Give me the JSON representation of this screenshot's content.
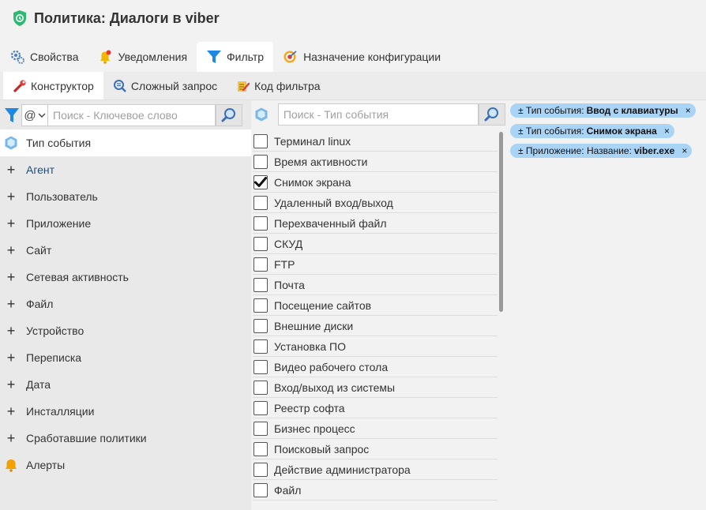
{
  "window": {
    "title": "Политика: Диалоги в viber"
  },
  "tabs": [
    {
      "label": "Свойства",
      "icon": "gear-icon"
    },
    {
      "label": "Уведомления",
      "icon": "bell-icon"
    },
    {
      "label": "Фильтр",
      "icon": "funnel-icon",
      "active": true
    },
    {
      "label": "Назначение конфигурации",
      "icon": "target-icon"
    }
  ],
  "subtabs": [
    {
      "label": "Конструктор",
      "icon": "wrench-icon",
      "active": true
    },
    {
      "label": "Сложный запрос",
      "icon": "query-icon"
    },
    {
      "label": "Код фильтра",
      "icon": "code-icon"
    }
  ],
  "left": {
    "operator": "@",
    "search_placeholder": "Поиск - Ключевое слово",
    "categories": [
      {
        "label": "Тип события",
        "prefix": "cube",
        "selected": true
      },
      {
        "label": "Агент",
        "prefix": "+"
      },
      {
        "label": "Пользователь",
        "prefix": "+"
      },
      {
        "label": "Приложение",
        "prefix": "+"
      },
      {
        "label": "Сайт",
        "prefix": "+"
      },
      {
        "label": "Сетевая активность",
        "prefix": "+"
      },
      {
        "label": "Файл",
        "prefix": "+"
      },
      {
        "label": "Устройство",
        "prefix": "+"
      },
      {
        "label": "Переписка",
        "prefix": "+"
      },
      {
        "label": "Дата",
        "prefix": "+"
      },
      {
        "label": "Инсталляции",
        "prefix": "+"
      },
      {
        "label": "Сработавшие политики",
        "prefix": "+"
      },
      {
        "label": "Алерты",
        "prefix": "bell"
      }
    ]
  },
  "middle": {
    "search_placeholder": "Поиск - Тип события",
    "items": [
      {
        "label": "Терминал linux",
        "checked": false
      },
      {
        "label": "Время активности",
        "checked": false
      },
      {
        "label": "Снимок экрана",
        "checked": true
      },
      {
        "label": "Удаленный вход/выход",
        "checked": false
      },
      {
        "label": "Перехваченный файл",
        "checked": false
      },
      {
        "label": "СКУД",
        "checked": false
      },
      {
        "label": "FTP",
        "checked": false
      },
      {
        "label": "Почта",
        "checked": false
      },
      {
        "label": "Посещение сайтов",
        "checked": false
      },
      {
        "label": "Внешние диски",
        "checked": false
      },
      {
        "label": "Установка ПО",
        "checked": false
      },
      {
        "label": "Видео рабочего стола",
        "checked": false
      },
      {
        "label": "Вход/выход из системы",
        "checked": false
      },
      {
        "label": "Реестр софта",
        "checked": false
      },
      {
        "label": "Бизнес процесс",
        "checked": false
      },
      {
        "label": "Поисковый запрос",
        "checked": false
      },
      {
        "label": "Действие администратора",
        "checked": false
      },
      {
        "label": "Файл",
        "checked": false
      }
    ]
  },
  "chips": [
    {
      "prefix": "± Тип события:",
      "value": "Ввод с клавиатуры",
      "close": "×"
    },
    {
      "prefix": "± Тип события:",
      "value": "Снимок экрана",
      "close": "×"
    },
    {
      "prefix": "± Приложение: Название:",
      "value": "viber.exe",
      "close": "×"
    }
  ],
  "colors": {
    "chip_bg": "#a9d4f5",
    "accent_blue": "#1e88e5",
    "shield_green": "#2eb872"
  }
}
